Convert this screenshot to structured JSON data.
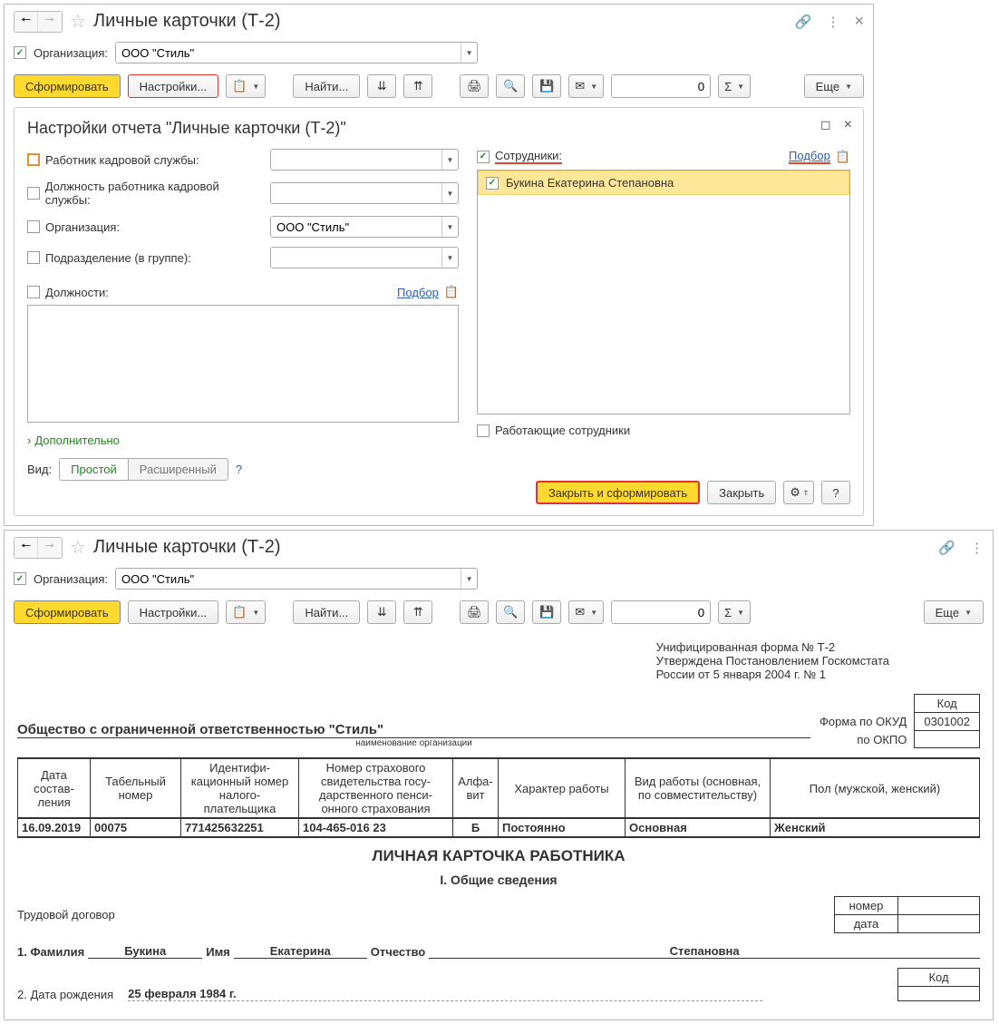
{
  "window1": {
    "title": "Личные карточки (Т-2)",
    "filter": {
      "org_label": "Организация:",
      "org_value": "ООО \"Стиль\""
    },
    "toolbar": {
      "form": "Сформировать",
      "settings": "Настройки...",
      "find": "Найти...",
      "more": "Еще",
      "num": "0"
    },
    "settings": {
      "title": "Настройки отчета \"Личные карточки (Т-2)\"",
      "rows": {
        "r1": "Работник кадровой службы:",
        "r2": "Должность работника кадровой службы:",
        "r3": "Организация:",
        "r3v": "ООО \"Стиль\"",
        "r4": "Подразделение (в группе):",
        "r5": "Должности:",
        "r5_link": "Подбор",
        "emp_label": "Сотрудники:",
        "emp_link": "Подбор",
        "emp_item": "Букина Екатерина Степановна",
        "working": "Работающие сотрудники",
        "more": "Дополнительно",
        "view_label": "Вид:",
        "simple": "Простой",
        "extended": "Расширенный",
        "close_form": "Закрыть и сформировать",
        "close": "Закрыть"
      }
    }
  },
  "window2": {
    "title": "Личные карточки (Т-2)",
    "filter": {
      "org_label": "Организация:",
      "org_value": "ООО \"Стиль\""
    },
    "toolbar": {
      "form": "Сформировать",
      "settings": "Настройки...",
      "find": "Найти...",
      "more": "Еще",
      "num": "0"
    },
    "doc": {
      "h1": "Унифицированная форма № Т-2",
      "h2": "Утверждена Постановлением Госкомстата",
      "h3": "России от 5 января 2004 г. № 1",
      "kod": "Код",
      "okud_label": "Форма по ОКУД",
      "okud": "0301002",
      "okpo_label": "по ОКПО",
      "org": "Общество с ограниченной ответственностью \"Стиль\"",
      "org_caption": "наименование организации",
      "cols": {
        "c1": "Дата состав- ления",
        "c2": "Табельный номер",
        "c3": "Идентифи- кационный номер налого- плательщика",
        "c4": "Номер страхового свидетельства госу- дарственного пенси- онного страхования",
        "c5": "Алфа- вит",
        "c6": "Характер работы",
        "c7": "Вид работы (основная, по совместительству)",
        "c8": "Пол (мужской, женский)"
      },
      "vals": {
        "v1": "16.09.2019",
        "v2": "00075",
        "v3": "771425632251",
        "v4": "104-465-016 23",
        "v5": "Б",
        "v6": "Постоянно",
        "v7": "Основная",
        "v8": "Женский"
      },
      "main_title": "ЛИЧНАЯ КАРТОЧКА РАБОТНИКА",
      "section": "I. Общие сведения",
      "contract": "Трудовой договор",
      "contract_num": "номер",
      "contract_date": "дата",
      "fam": "1. Фамилия",
      "fam_v": "Букина",
      "name": "Имя",
      "name_v": "Екатерина",
      "otch": "Отчество",
      "otch_v": "Степановна",
      "birth": "2. Дата рождения",
      "birth_v": "25 февраля 1984 г.",
      "kod2": "Код"
    }
  }
}
